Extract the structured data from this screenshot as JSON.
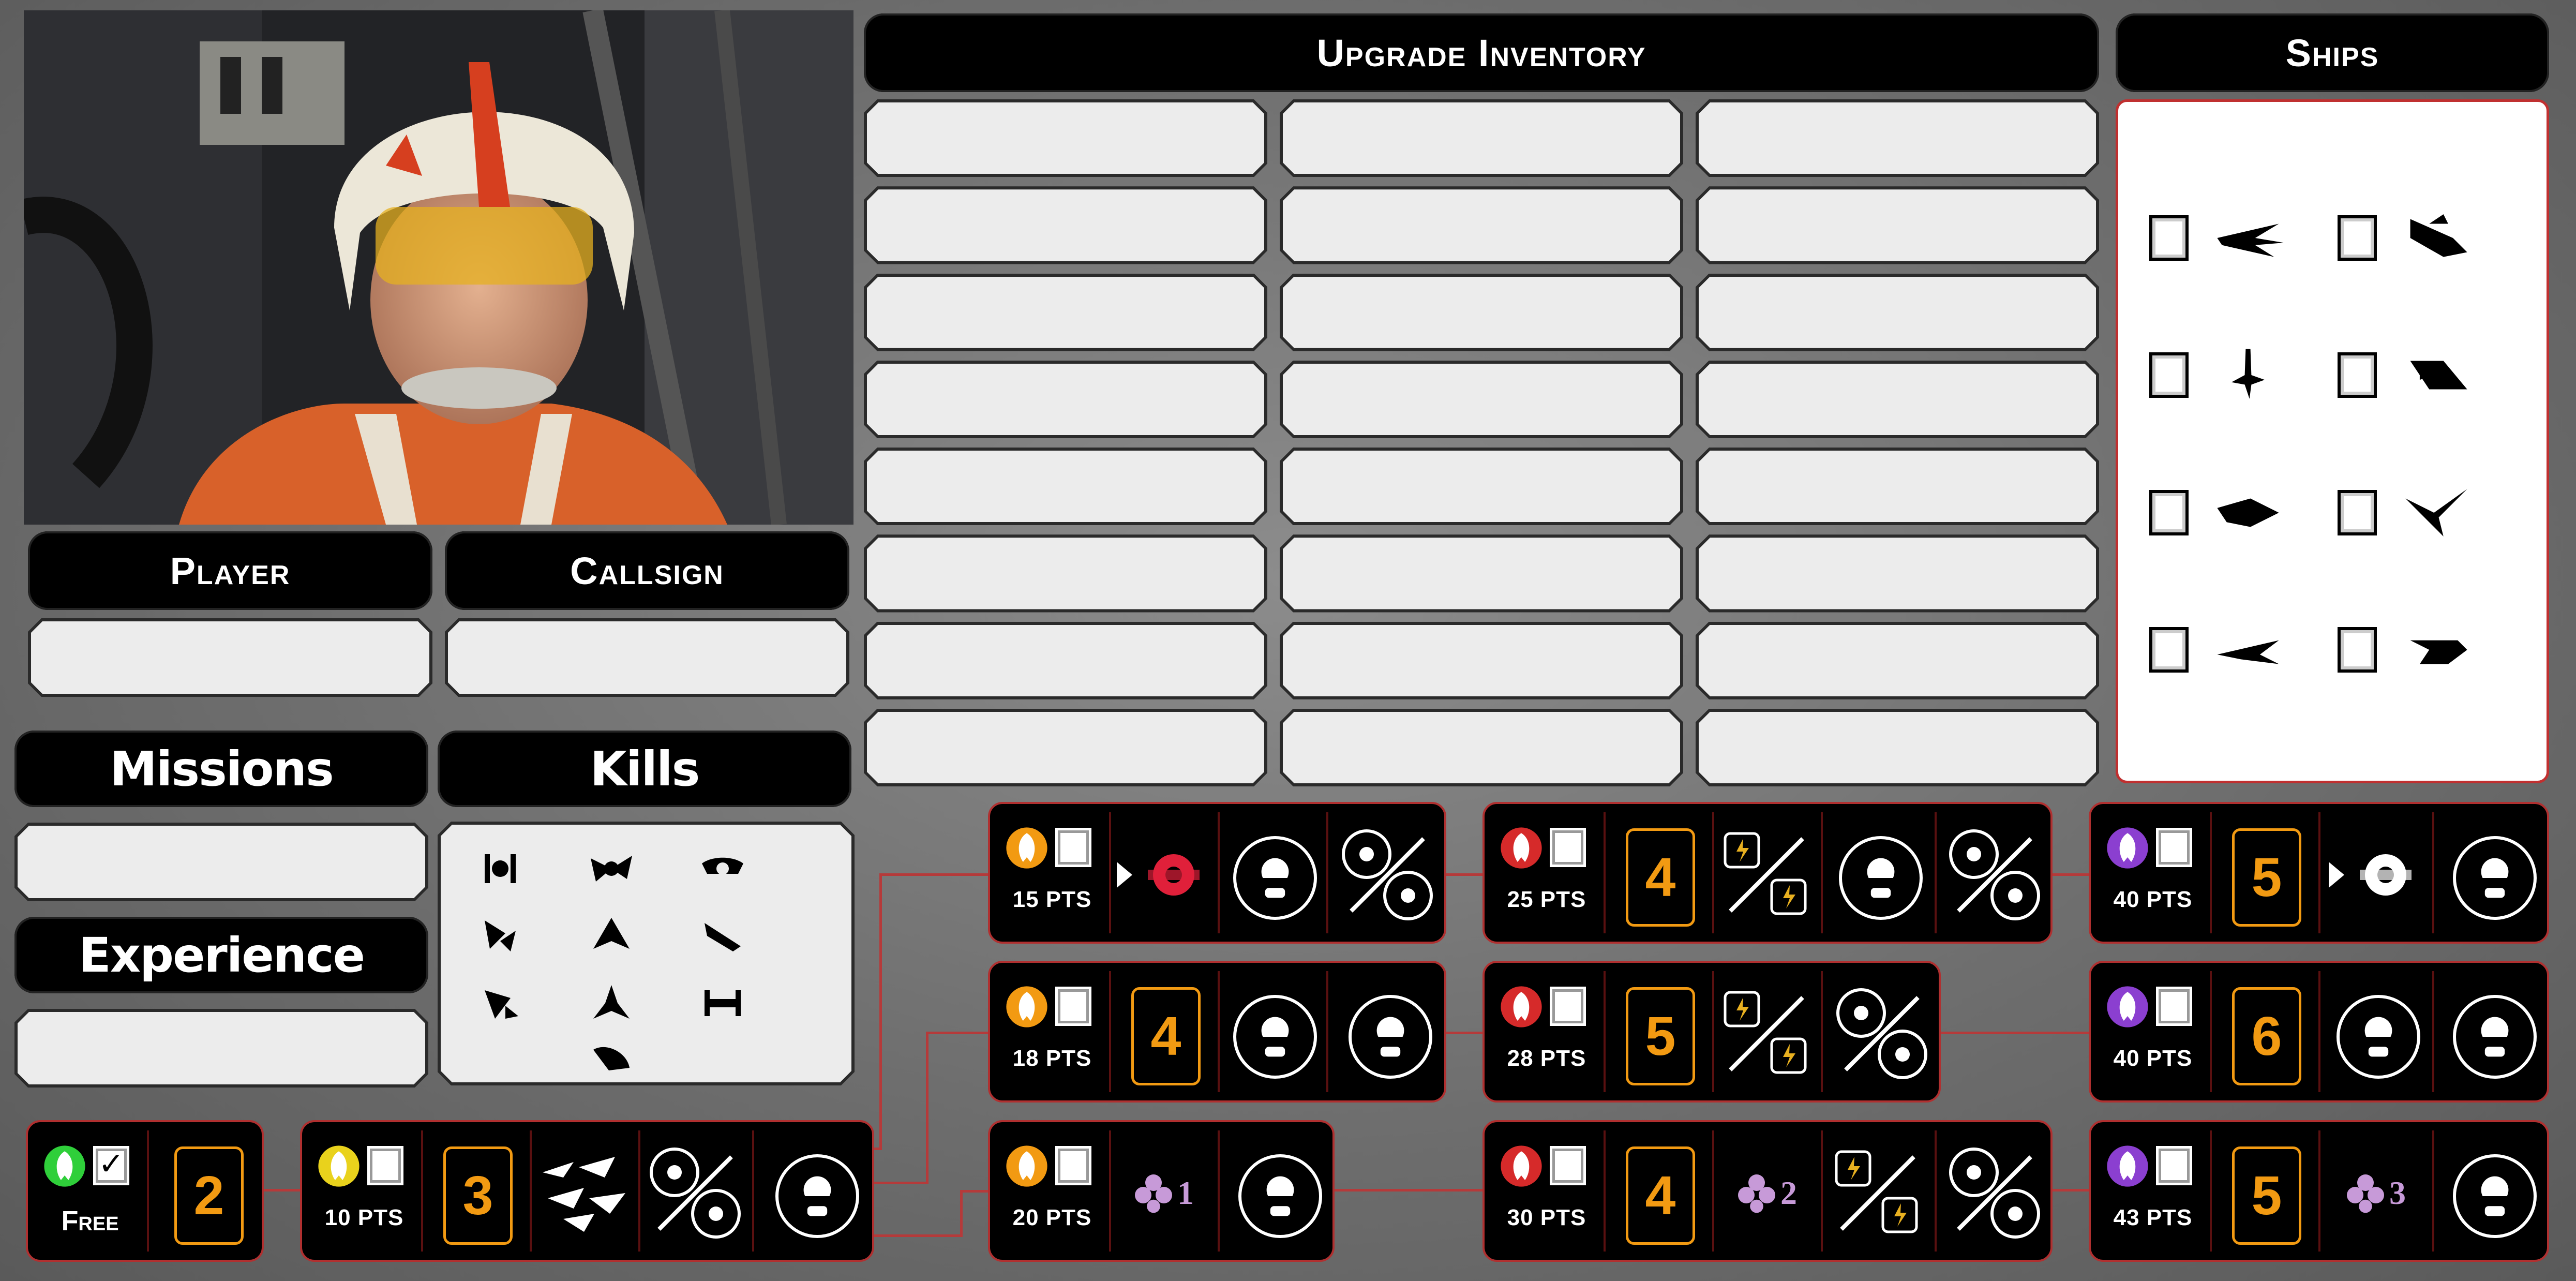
{
  "headers": {
    "upgrade_inventory": "Upgrade Inventory",
    "ships": "Ships",
    "player": "Player",
    "callsign": "Callsign",
    "missions": "Missions",
    "kills": "Kills",
    "experience": "Experience"
  },
  "fields": {
    "player": "",
    "callsign": "",
    "missions": "",
    "experience": ""
  },
  "upgrade_slots": {
    "rows": 8,
    "cols": 3
  },
  "ships": [
    {
      "icon": "x-wing-icon",
      "checked": false
    },
    {
      "icon": "y-wing-icon",
      "checked": false
    },
    {
      "icon": "b-wing-icon",
      "checked": false
    },
    {
      "icon": "yt-1300-icon",
      "checked": false
    },
    {
      "icon": "a-wing-icon",
      "checked": false
    },
    {
      "icon": "e-wing-icon",
      "checked": false
    },
    {
      "icon": "z-95-icon",
      "checked": false
    },
    {
      "icon": "k-wing-icon",
      "checked": false
    }
  ],
  "kill_icons": [
    "tie-fighter-icon",
    "tie-interceptor-icon",
    "tie-bomber-icon",
    "tie-defender-icon",
    "tie-phantom-icon",
    "lambda-shuttle-icon",
    "tie-advanced-icon",
    "firespray-icon",
    "tie-punisher-icon",
    "vt-49-icon"
  ],
  "cards": [
    {
      "id": "free",
      "cost": "Free",
      "checked": true,
      "faction_color": "#2fcf3a",
      "level": "2"
    },
    {
      "id": "c10",
      "cost": "10 PTS",
      "checked": false,
      "faction_color": "#e9d21c",
      "level": "3"
    },
    {
      "id": "c15",
      "cost": "15 PTS",
      "checked": false,
      "faction_color": "#f29a12"
    },
    {
      "id": "c18",
      "cost": "18 PTS",
      "checked": false,
      "faction_color": "#f29a12",
      "level": "4"
    },
    {
      "id": "c20",
      "cost": "20 PTS",
      "checked": false,
      "faction_color": "#f29a12",
      "bonus": "1"
    },
    {
      "id": "c25",
      "cost": "25 PTS",
      "checked": false,
      "faction_color": "#d62a2a",
      "level": "4"
    },
    {
      "id": "c28",
      "cost": "28 PTS",
      "checked": false,
      "faction_color": "#d62a2a",
      "level": "5"
    },
    {
      "id": "c30",
      "cost": "30 PTS",
      "checked": false,
      "faction_color": "#d62a2a",
      "level": "4",
      "bonus": "2"
    },
    {
      "id": "c40a",
      "cost": "40 PTS",
      "checked": false,
      "faction_color": "#8b3fd0",
      "level": "5"
    },
    {
      "id": "c40b",
      "cost": "40 PTS",
      "checked": false,
      "faction_color": "#8b3fd0",
      "level": "6"
    },
    {
      "id": "c43",
      "cost": "43 PTS",
      "checked": false,
      "faction_color": "#8b3fd0",
      "level": "5",
      "bonus": "3"
    }
  ],
  "colors": {
    "accent_orange": "#f29a12",
    "link_red": "#b53a3a",
    "panel_border": "#c03030"
  }
}
